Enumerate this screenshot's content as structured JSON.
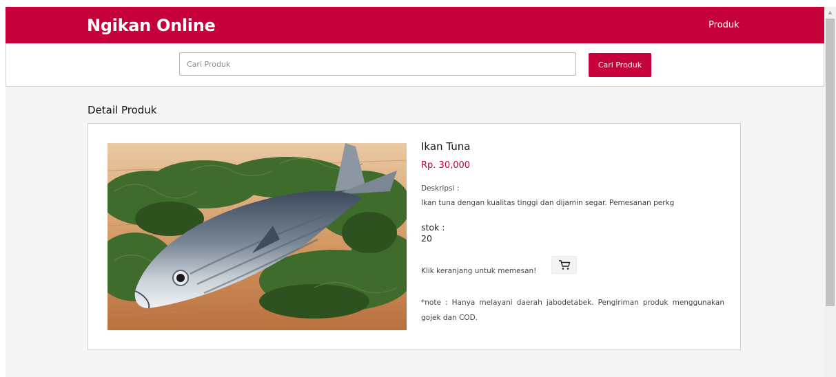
{
  "header": {
    "brand": "Ngikan Online",
    "nav_produk": "Produk"
  },
  "search": {
    "placeholder": "Cari Produk",
    "button_label": "Cari Produk"
  },
  "section": {
    "title": "Detail Produk"
  },
  "product": {
    "name": "Ikan Tuna",
    "price": "Rp. 30,000",
    "description_label": "Deskripsi :",
    "description": "Ikan tuna dengan kualitas tinggi dan dijamin segar. Pemesanan perkg",
    "stock_label": "stok :",
    "stock_value": "20",
    "order_prompt": "Klik keranjang untuk memesan!",
    "note": "*note : Hanya melayani daerah jabodetabek. Pengiriman produk menggunakan gojek dan COD.",
    "image_icon": "fish-photo"
  },
  "icons": {
    "cart": "shopping-cart-icon",
    "scroll_up": "chevron-up-icon"
  },
  "colors": {
    "brand": "#c5003a",
    "background": "#f5f5f5",
    "card": "#ffffff"
  }
}
